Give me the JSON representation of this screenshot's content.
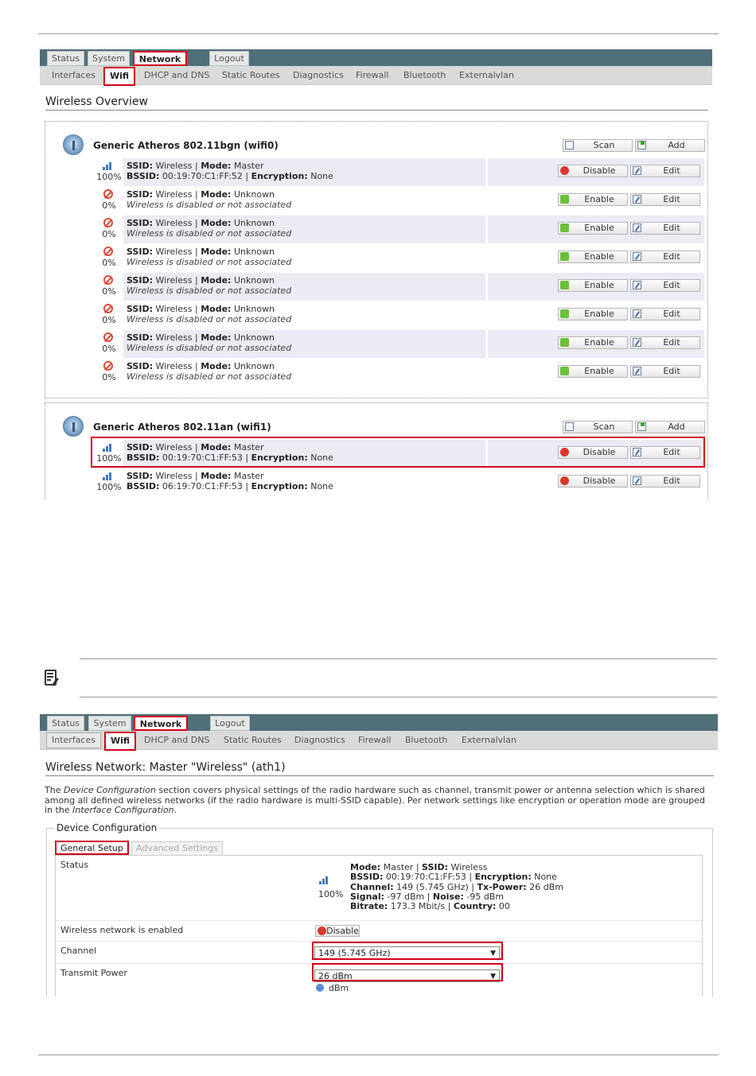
{
  "screenshot1": {
    "top_tabs": [
      "Status",
      "System",
      "Network",
      "Logout"
    ],
    "sub_tabs": [
      "Interfaces",
      "Wifi",
      "DHCP and DNS",
      "Static Routes",
      "Diagnostics",
      "Firewall",
      "Bluetooth",
      "Externalvlan"
    ],
    "page_title": "Wireless Overview",
    "devices": [
      {
        "name": "Generic Atheros 802.11bgn (wifi0)",
        "scan_label": "Scan",
        "add_label": "Add",
        "networks": [
          {
            "pct": "100%",
            "l1_ssid_k": "SSID:",
            "ssid": "Wireless",
            "mode_k": "Mode:",
            "mode": "Master",
            "bssid_k": "BSSID:",
            "bssid": "00:19:70:C1:FF:52",
            "enc_k": "Encryption:",
            "enc": "None",
            "action": "Disable",
            "edit": "Edit"
          },
          {
            "pct": "0%",
            "l1_ssid_k": "SSID:",
            "ssid": "Wireless",
            "mode_k": "Mode:",
            "mode": "Unknown",
            "note": "Wireless is disabled or not associated",
            "action": "Enable",
            "edit": "Edit"
          },
          {
            "pct": "0%",
            "l1_ssid_k": "SSID:",
            "ssid": "Wireless",
            "mode_k": "Mode:",
            "mode": "Unknown",
            "note": "Wireless is disabled or not associated",
            "action": "Enable",
            "edit": "Edit"
          },
          {
            "pct": "0%",
            "l1_ssid_k": "SSID:",
            "ssid": "Wireless",
            "mode_k": "Mode:",
            "mode": "Unknown",
            "note": "Wireless is disabled or not associated",
            "action": "Enable",
            "edit": "Edit"
          },
          {
            "pct": "0%",
            "l1_ssid_k": "SSID:",
            "ssid": "Wireless",
            "mode_k": "Mode:",
            "mode": "Unknown",
            "note": "Wireless is disabled or not associated",
            "action": "Enable",
            "edit": "Edit"
          },
          {
            "pct": "0%",
            "l1_ssid_k": "SSID:",
            "ssid": "Wireless",
            "mode_k": "Mode:",
            "mode": "Unknown",
            "note": "Wireless is disabled or not associated",
            "action": "Enable",
            "edit": "Edit"
          },
          {
            "pct": "0%",
            "l1_ssid_k": "SSID:",
            "ssid": "Wireless",
            "mode_k": "Mode:",
            "mode": "Unknown",
            "note": "Wireless is disabled or not associated",
            "action": "Enable",
            "edit": "Edit"
          },
          {
            "pct": "0%",
            "l1_ssid_k": "SSID:",
            "ssid": "Wireless",
            "mode_k": "Mode:",
            "mode": "Unknown",
            "note": "Wireless is disabled or not associated",
            "action": "Enable",
            "edit": "Edit"
          }
        ]
      },
      {
        "name": "Generic Atheros 802.11an (wifi1)",
        "scan_label": "Scan",
        "add_label": "Add",
        "networks": [
          {
            "pct": "100%",
            "l1_ssid_k": "SSID:",
            "ssid": "Wireless",
            "mode_k": "Mode:",
            "mode": "Master",
            "bssid_k": "BSSID:",
            "bssid": "00:19:70:C1:FF:53",
            "enc_k": "Encryption:",
            "enc": "None",
            "action": "Disable",
            "edit": "Edit"
          },
          {
            "pct": "100%",
            "l1_ssid_k": "SSID:",
            "ssid": "Wireless",
            "mode_k": "Mode:",
            "mode": "Master",
            "bssid_k": "BSSID:",
            "bssid": "06:19:70:C1:FF:53",
            "enc_k": "Encryption:",
            "enc": "None",
            "action": "Disable",
            "edit": "Edit"
          }
        ]
      }
    ]
  },
  "screenshot2": {
    "top_tabs": [
      "Status",
      "System",
      "Network",
      "Logout"
    ],
    "sub_tabs": [
      "Interfaces",
      "Wifi",
      "DHCP and DNS",
      "Static Routes",
      "Diagnostics",
      "Firewall",
      "Bluetooth",
      "Externalvlan"
    ],
    "page_title": "Wireless Network: Master \"Wireless\" (ath1)",
    "desc_1": "The ",
    "desc_em1": "Device Configuration",
    "desc_2": " section covers physical settings of the radio hardware such as channel, transmit power or antenna selection which is shared among all defined wireless networks (if the radio hardware is multi-SSID capable). Per network settings like encryption or operation mode are grouped in the ",
    "desc_em2": "Interface Configuration",
    "desc_3": ".",
    "section_legend": "Device Configuration",
    "tab_general": "General Setup",
    "tab_advanced": "Advanced Settings",
    "status_label": "Status",
    "status_pct": "100%",
    "status_lines": {
      "mode_k": "Mode:",
      "mode": "Master",
      "ssid_k": "SSID:",
      "ssid": "Wireless",
      "bssid_k": "BSSID:",
      "bssid": "00:19:70:C1:FF:53",
      "enc_k": "Encryption:",
      "enc": "None",
      "channel_k": "Channel:",
      "channel": "149 (5.745 GHz)",
      "txp_k": "Tx-Power:",
      "txp": "26 dBm",
      "signal_k": "Signal:",
      "signal": "-97 dBm",
      "noise_k": "Noise:",
      "noise": "-95 dBm",
      "bitrate_k": "Bitrate:",
      "bitrate": "173.3 Mbit/s",
      "country_k": "Country:",
      "country": "00"
    },
    "enabled_label": "Wireless network is enabled",
    "disable_btn": "Disable",
    "channel_label": "Channel",
    "channel_value": "149 (5.745 GHz)",
    "txpower_label": "Transmit Power",
    "txpower_value": "26 dBm",
    "txpower_unit": "dBm"
  }
}
